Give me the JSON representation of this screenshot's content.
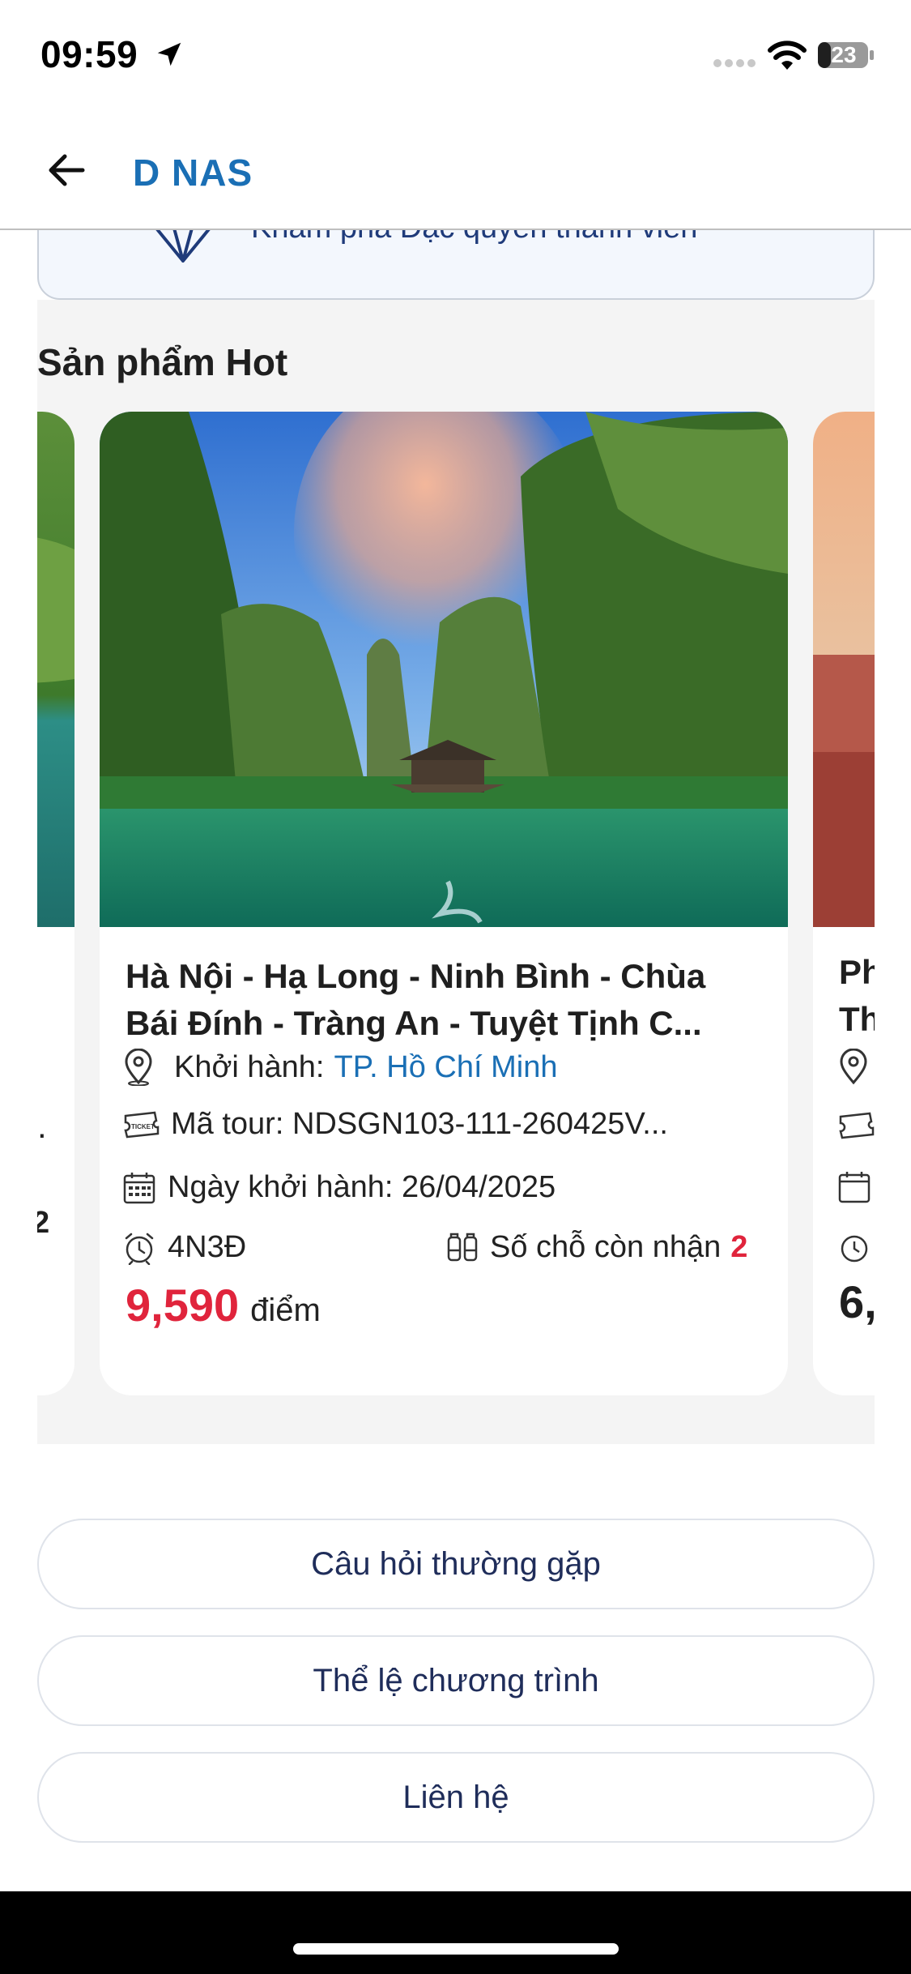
{
  "status_bar": {
    "time": "09:59",
    "battery": "23"
  },
  "header": {
    "title": "D NAS"
  },
  "banner": {
    "text": "Khám phá Đặc quyền thành viên"
  },
  "hot_section": {
    "title": "Sản phẩm Hot",
    "main_card": {
      "title": "Hà Nội - Hạ Long - Ninh Bình - Chùa Bái Đính - Tràng An - Tuyệt Tịnh C...",
      "departure_label": "Khởi hành:",
      "departure_value": "TP. Hồ Chí Minh",
      "tour_code": "Mã tour: NDSGN103-111-260425V...",
      "departure_date": "Ngày khởi hành: 26/04/2025",
      "duration": "4N3Đ",
      "seats_label": "Số chỗ còn nhận",
      "seats_value": "2",
      "price_value": "9,590",
      "price_unit": "điểm"
    },
    "left_card": {
      "seats_value": "2",
      "dot": "."
    },
    "right_card": {
      "title_line1": "Ph",
      "title_line2": "Th",
      "price_partial": "6,"
    }
  },
  "buttons": {
    "faq": "Câu hỏi thường gặp",
    "rules": "Thể lệ chương trình",
    "contact": "Liên hệ"
  },
  "colors": {
    "brand_blue": "#1a6fb5",
    "price_red": "#e0243c",
    "navy": "#1f2d5a"
  }
}
